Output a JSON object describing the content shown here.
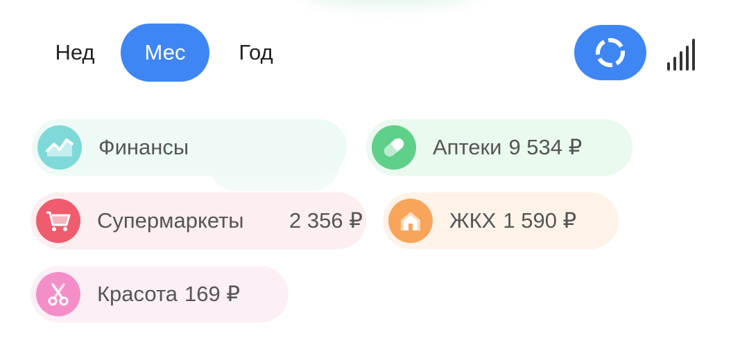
{
  "periods": [
    {
      "label": "Нед",
      "selected": false
    },
    {
      "label": "Мес",
      "selected": true
    },
    {
      "label": "Год",
      "selected": false
    }
  ],
  "view_toggle": {
    "donut_icon": "donut-chart-icon",
    "bars_icon": "bar-chart-icon",
    "active": "donut",
    "accent": "#3f86f5"
  },
  "categories": [
    {
      "id": "finance",
      "label": "Финансы",
      "amount": "",
      "icon": "trend-chart-icon",
      "color": "#7fd9d9"
    },
    {
      "id": "pharmacy",
      "label": "Аптеки",
      "amount": "9 534 ₽",
      "icon": "pill-icon",
      "color": "#5ed08a"
    },
    {
      "id": "supermarket",
      "label": "Супермаркеты",
      "amount": "2 356 ₽",
      "icon": "cart-icon",
      "color": "#ee5c6d"
    },
    {
      "id": "utilities",
      "label": "ЖКХ",
      "amount": "1 590 ₽",
      "icon": "house-icon",
      "color": "#f7a55a"
    },
    {
      "id": "beauty",
      "label": "Красота",
      "amount": "169 ₽",
      "icon": "scissors-icon",
      "color": "#f48ec9"
    }
  ]
}
